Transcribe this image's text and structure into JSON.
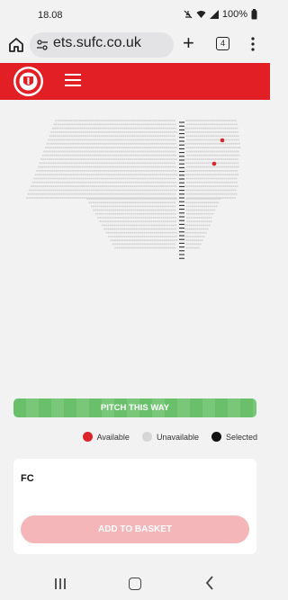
{
  "status": {
    "time": "18.08",
    "battery": "100%"
  },
  "browser": {
    "url": "ets.sufc.co.uk",
    "tab_count": "4"
  },
  "legend": {
    "available": "Available",
    "unavailable": "Unavailable",
    "selected": "Selected"
  },
  "pitch_label": "PITCH THIS WAY",
  "basket": {
    "section_name": "FC",
    "add_label": "ADD TO BASKET"
  },
  "colors": {
    "brand_red": "#e31f26",
    "pitch_green": "#6ac06a",
    "available": "#d9252b",
    "unavailable": "#d6d6d6",
    "selected": "#111111"
  }
}
